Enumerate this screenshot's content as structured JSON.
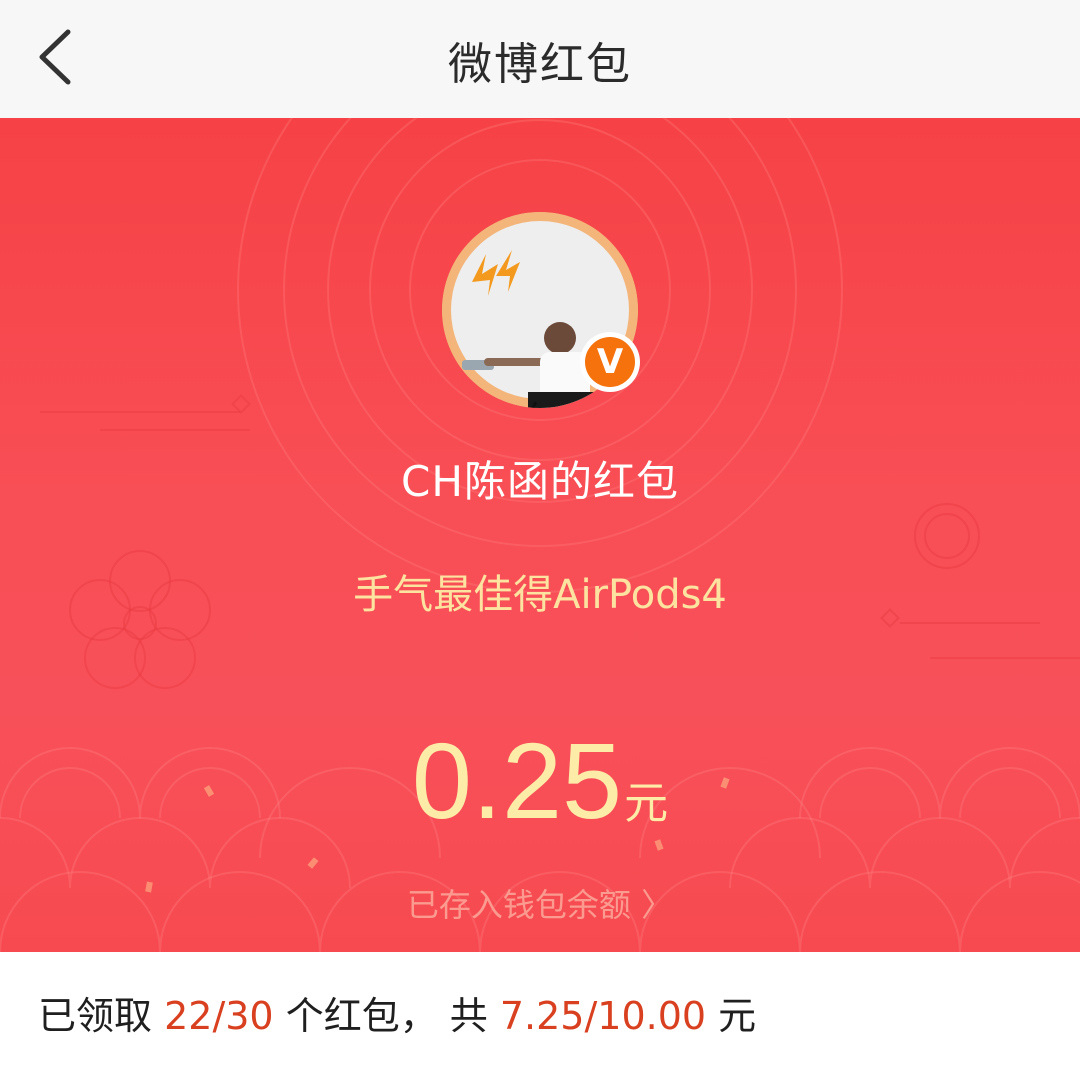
{
  "header": {
    "title": "微博红包"
  },
  "envelope": {
    "sender_title": "CH陈函的红包",
    "subtitle": "手气最佳得AirPods4",
    "amount": "0.25",
    "amount_unit": "元",
    "wallet_link": "已存入钱包余额 〉",
    "verified_badge": "V"
  },
  "summary": {
    "prefix": "已领取 ",
    "received_count": "22/30",
    "middle": " 个红包， 共 ",
    "received_amount": "7.25/10.00",
    "suffix": " 元"
  },
  "colors": {
    "envelope_red": "#f84e55",
    "amount_yellow": "#fdeba8",
    "highlight_red": "#d9401f",
    "badge_orange": "#f6720c"
  },
  "icons": {
    "back": "chevron-left-icon",
    "verified": "verified-v-icon"
  }
}
